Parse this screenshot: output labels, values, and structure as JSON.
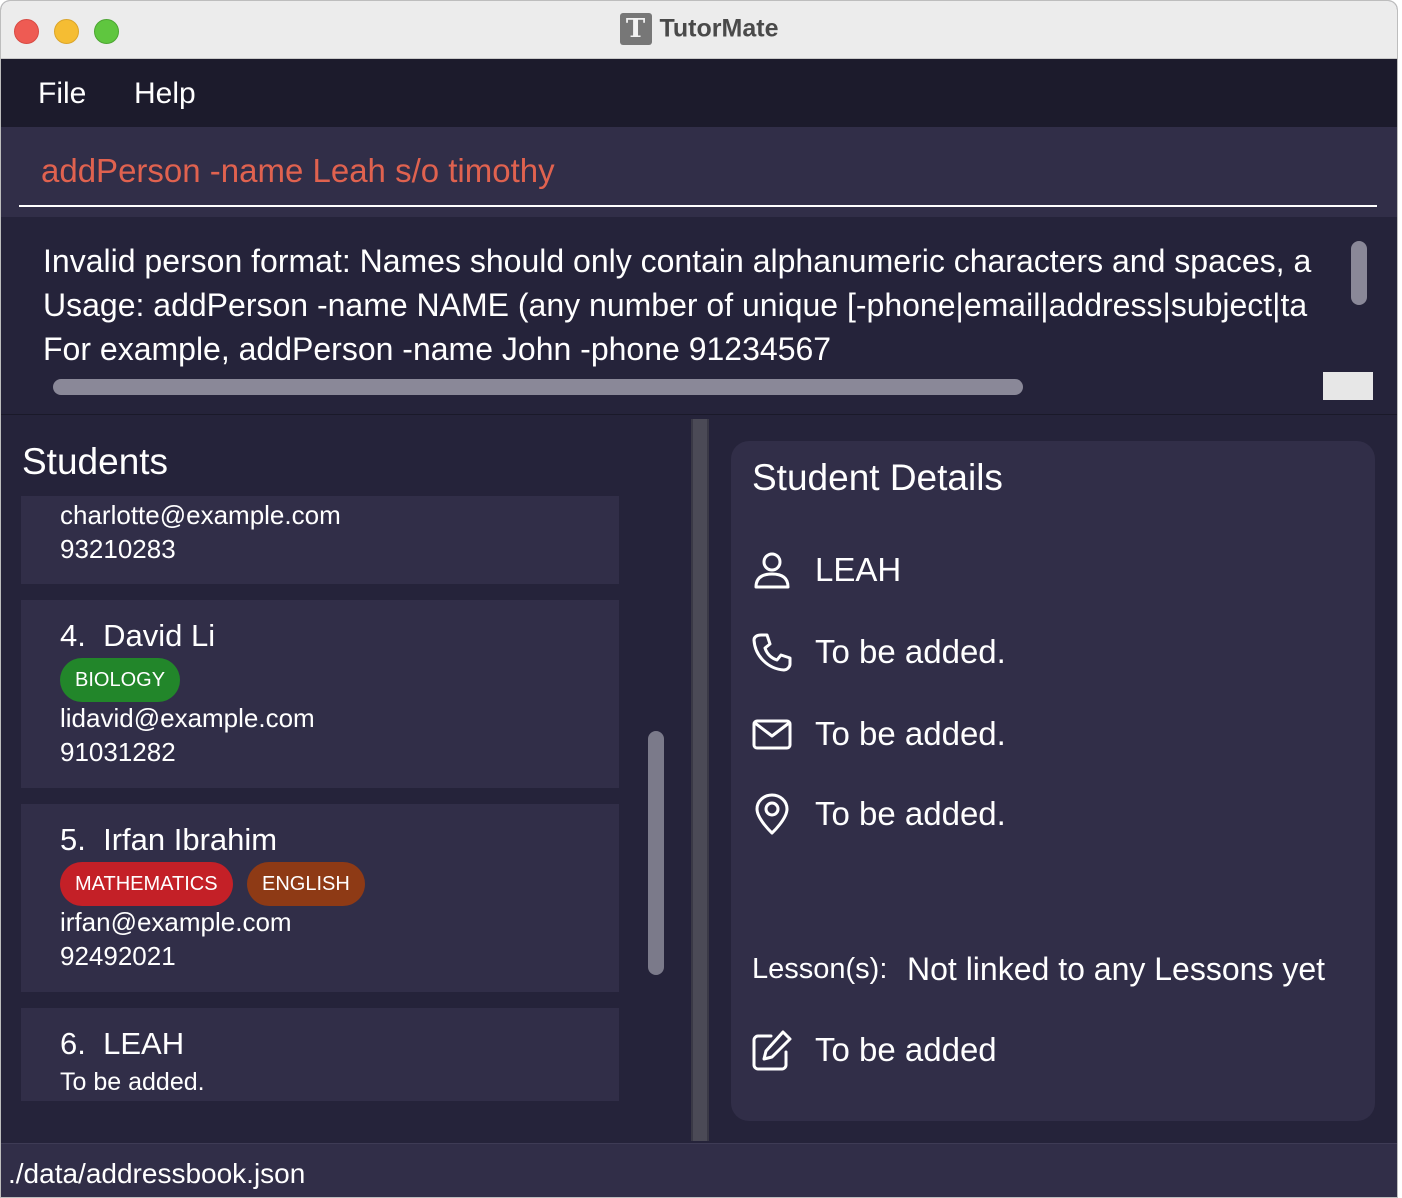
{
  "window": {
    "title": "TutorMate",
    "logo_letter": "T"
  },
  "menu": {
    "file": "File",
    "help": "Help"
  },
  "command": {
    "value": "addPerson -name Leah s/o timothy"
  },
  "result": {
    "lines": [
      "Invalid person format: Names should only contain alphanumeric characters and spaces, a",
      "Usage: addPerson -name NAME (any number of unique [-phone|email|address|subject|ta",
      "For example, addPerson -name John -phone 91234567"
    ]
  },
  "students": {
    "title": "Students",
    "cards": [
      {
        "email": "charlotte@example.com",
        "phone": "93210283"
      },
      {
        "index": "4.",
        "name": "David Li",
        "tags": [
          "BIOLOGY"
        ],
        "email": "lidavid@example.com",
        "phone": "91031282"
      },
      {
        "index": "5.",
        "name": "Irfan Ibrahim",
        "tags": [
          "MATHEMATICS",
          "ENGLISH"
        ],
        "email": "irfan@example.com",
        "phone": "92492021"
      },
      {
        "index": "6.",
        "name": "LEAH",
        "line": "To be added."
      }
    ]
  },
  "details": {
    "title": "Student Details",
    "name": "LEAH",
    "phone": "To be added.",
    "email": "To be added.",
    "address": "To be added.",
    "lessons_label": "Lesson(s):",
    "lessons_value": "Not linked to any Lessons yet",
    "remark": "To be added"
  },
  "status": {
    "path": "./data/addressbook.json"
  },
  "colors": {
    "tag_biology": "#22862a",
    "tag_mathematics": "#c42027",
    "tag_english": "#8e3a15",
    "command_text": "#e0624f",
    "panel_bg": "#312e48",
    "app_bg": "#25233a"
  },
  "icons": {
    "name": "person-icon",
    "phone": "phone-icon",
    "email": "mail-icon",
    "address": "location-pin-icon",
    "remark": "edit-icon"
  }
}
